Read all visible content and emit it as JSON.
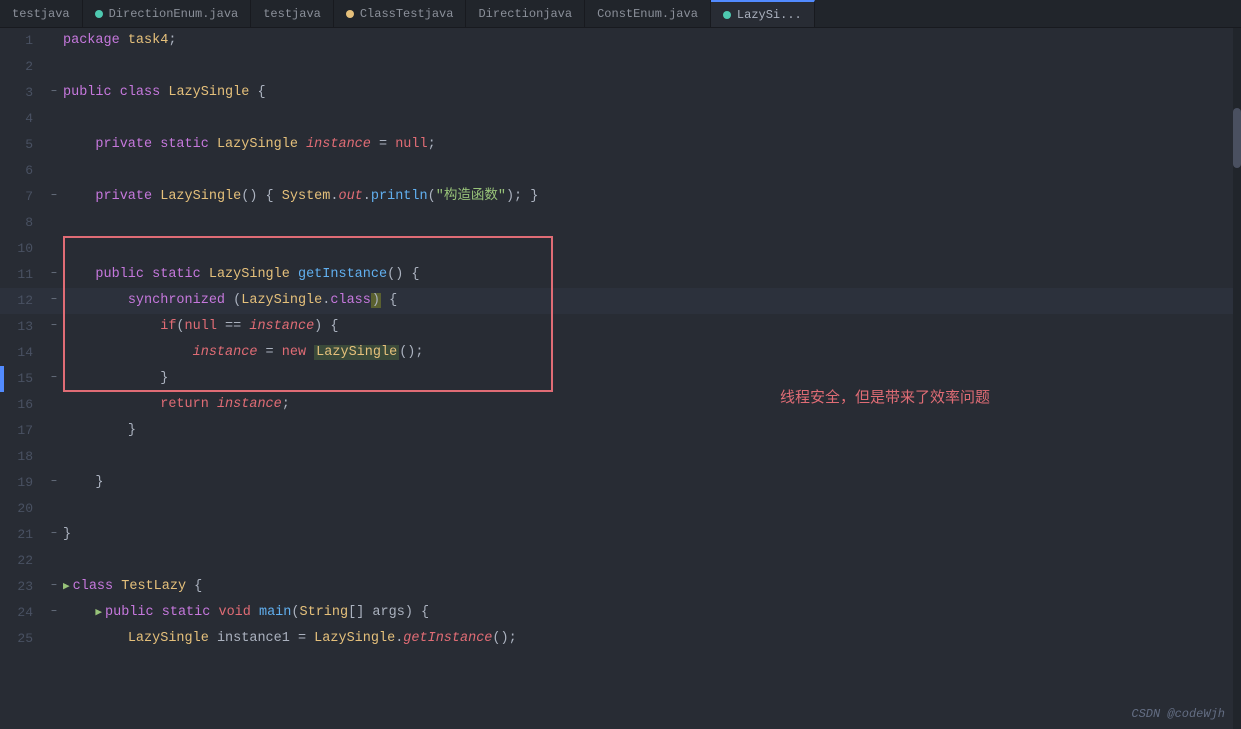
{
  "tabs": [
    {
      "label": "testjava",
      "active": false,
      "dot": null
    },
    {
      "label": "DirectionEnum.java",
      "active": false,
      "dot": "blue"
    },
    {
      "label": "testjava",
      "active": false,
      "dot": null
    },
    {
      "label": "ClassTestjava",
      "active": false,
      "dot": "orange"
    },
    {
      "label": "Directionjava",
      "active": false,
      "dot": null
    },
    {
      "label": "ConstEnum.java",
      "active": false,
      "dot": null
    },
    {
      "label": "LazySi...",
      "active": true,
      "dot": "blue"
    }
  ],
  "lines": [
    {
      "num": 1,
      "fold": "",
      "indent": 1,
      "content": "package task4;"
    },
    {
      "num": 2,
      "fold": "",
      "indent": 0,
      "content": ""
    },
    {
      "num": 3,
      "fold": "open",
      "indent": 0,
      "content": "public class LazySingle {"
    },
    {
      "num": 4,
      "fold": "",
      "indent": 0,
      "content": ""
    },
    {
      "num": 5,
      "fold": "",
      "indent": 2,
      "content": "private static LazySingle instance = null;"
    },
    {
      "num": 6,
      "fold": "",
      "indent": 0,
      "content": ""
    },
    {
      "num": 7,
      "fold": "open",
      "indent": 2,
      "content": "private LazySingle() { System.out.println(\"构造函数\"); }"
    },
    {
      "num": 8,
      "fold": "",
      "indent": 0,
      "content": ""
    },
    {
      "num": 10,
      "fold": "",
      "indent": 0,
      "content": ""
    },
    {
      "num": 11,
      "fold": "open",
      "indent": 2,
      "content": "public static LazySingle getInstance() {"
    },
    {
      "num": 12,
      "fold": "open",
      "indent": 3,
      "content": "synchronized (LazySingle.class) {"
    },
    {
      "num": 13,
      "fold": "",
      "indent": 4,
      "content": "if(null == instance) {"
    },
    {
      "num": 14,
      "fold": "",
      "indent": 5,
      "content": "instance = new LazySingle();"
    },
    {
      "num": 15,
      "fold": "open",
      "indent": 4,
      "content": "}"
    },
    {
      "num": 16,
      "fold": "",
      "indent": 4,
      "content": "return instance;"
    },
    {
      "num": 17,
      "fold": "",
      "indent": 3,
      "content": "}"
    },
    {
      "num": 18,
      "fold": "",
      "indent": 0,
      "content": ""
    },
    {
      "num": 19,
      "fold": "open",
      "indent": 2,
      "content": "}"
    },
    {
      "num": 20,
      "fold": "",
      "indent": 0,
      "content": ""
    },
    {
      "num": 21,
      "fold": "open",
      "indent": 0,
      "content": "}"
    },
    {
      "num": 22,
      "fold": "",
      "indent": 0,
      "content": ""
    },
    {
      "num": 23,
      "fold": "open",
      "indent": 0,
      "content": "class TestLazy {"
    },
    {
      "num": 24,
      "fold": "open",
      "indent": 2,
      "content": "public static void main(String[] args) {"
    },
    {
      "num": 25,
      "fold": "",
      "indent": 3,
      "content": "LazySingle instance1 = LazySingle.getInstance();"
    }
  ],
  "annotation": "线程安全，但是带来了效率问题",
  "branding": "CSDN @codeWjh",
  "colors": {
    "bg": "#282c34",
    "line_active": "#2c313c",
    "keyword": "#c678dd",
    "keyword2": "#e06c75",
    "type": "#e5c07b",
    "method": "#61afef",
    "string": "#98c379",
    "variable_italic": "#e06c75",
    "number_gutter": "#495162",
    "highlight_border": "#e06c75",
    "annotation_text": "#e06c75"
  }
}
